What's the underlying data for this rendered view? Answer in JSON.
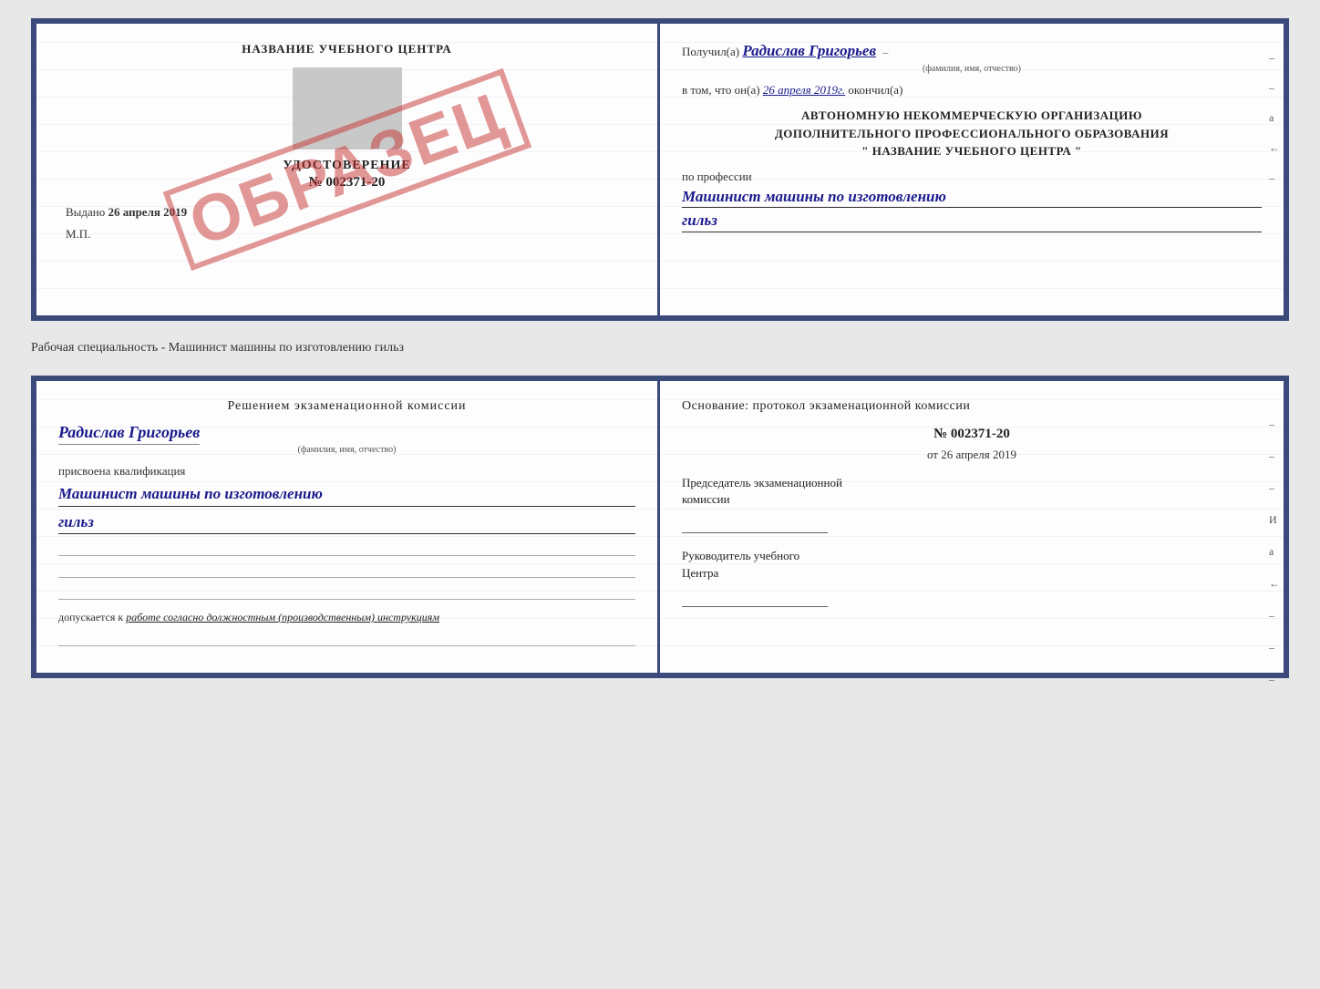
{
  "top_left": {
    "title": "НАЗВАНИЕ УЧЕБНОГО ЦЕНТРА",
    "udostoverenie_label": "УДОСТОВЕРЕНИЕ",
    "number": "№ 002371-20",
    "vydano": "Выдано",
    "vydano_date": "26 апреля 2019",
    "mp": "М.П.",
    "stamp": "ОБРАЗЕЦ"
  },
  "top_right": {
    "poluchil_prefix": "Получил(а)",
    "name": "Радислав Григорьев",
    "fio_label": "(фамилия, имя, отчество)",
    "vtom_prefix": "в том, что он(а)",
    "date": "26 апреля 2019г.",
    "okonchil": "окончил(а)",
    "org_line1": "АВТОНОМНУЮ НЕКОММЕРЧЕСКУЮ ОРГАНИЗАЦИЮ",
    "org_line2": "ДОПОЛНИТЕЛЬНОГО ПРОФЕССИОНАЛЬНОГО ОБРАЗОВАНИЯ",
    "org_line3": "\"  НАЗВАНИЕ УЧЕБНОГО ЦЕНТРА  \"",
    "po_professii": "по профессии",
    "profession1": "Машинист машины по изготовлению",
    "profession2": "гильз",
    "side_marks": [
      "–",
      "–",
      "а",
      "←",
      "–"
    ]
  },
  "middle_label": "Рабочая специальность - Машинист машины по изготовлению гильз",
  "bottom_left": {
    "resheniem": "Решением  экзаменационной  комиссии",
    "name": "Радислав Григорьев",
    "fio_label": "(фамилия, имя, отчество)",
    "prisvoena": "присвоена квалификация",
    "kvalf1": "Машинист  машины  по  изготовлению",
    "kvalf2": "гильз",
    "dopuskaetsya_prefix": "допускается к",
    "dopuskaetsya_text": "работе согласно должностным (производственным) инструкциям"
  },
  "bottom_right": {
    "osnovanie": "Основание: протокол экзаменационной  комиссии",
    "number": "№  002371-20",
    "ot_prefix": "от",
    "date": "26 апреля 2019",
    "predsedatel_line1": "Председатель экзаменационной",
    "predsedatel_line2": "комиссии",
    "rukovoditel_line1": "Руководитель учебного",
    "rukovoditel_line2": "Центра",
    "side_marks": [
      "–",
      "–",
      "–",
      "И",
      "а",
      "←",
      "–",
      "–",
      "–"
    ]
  }
}
